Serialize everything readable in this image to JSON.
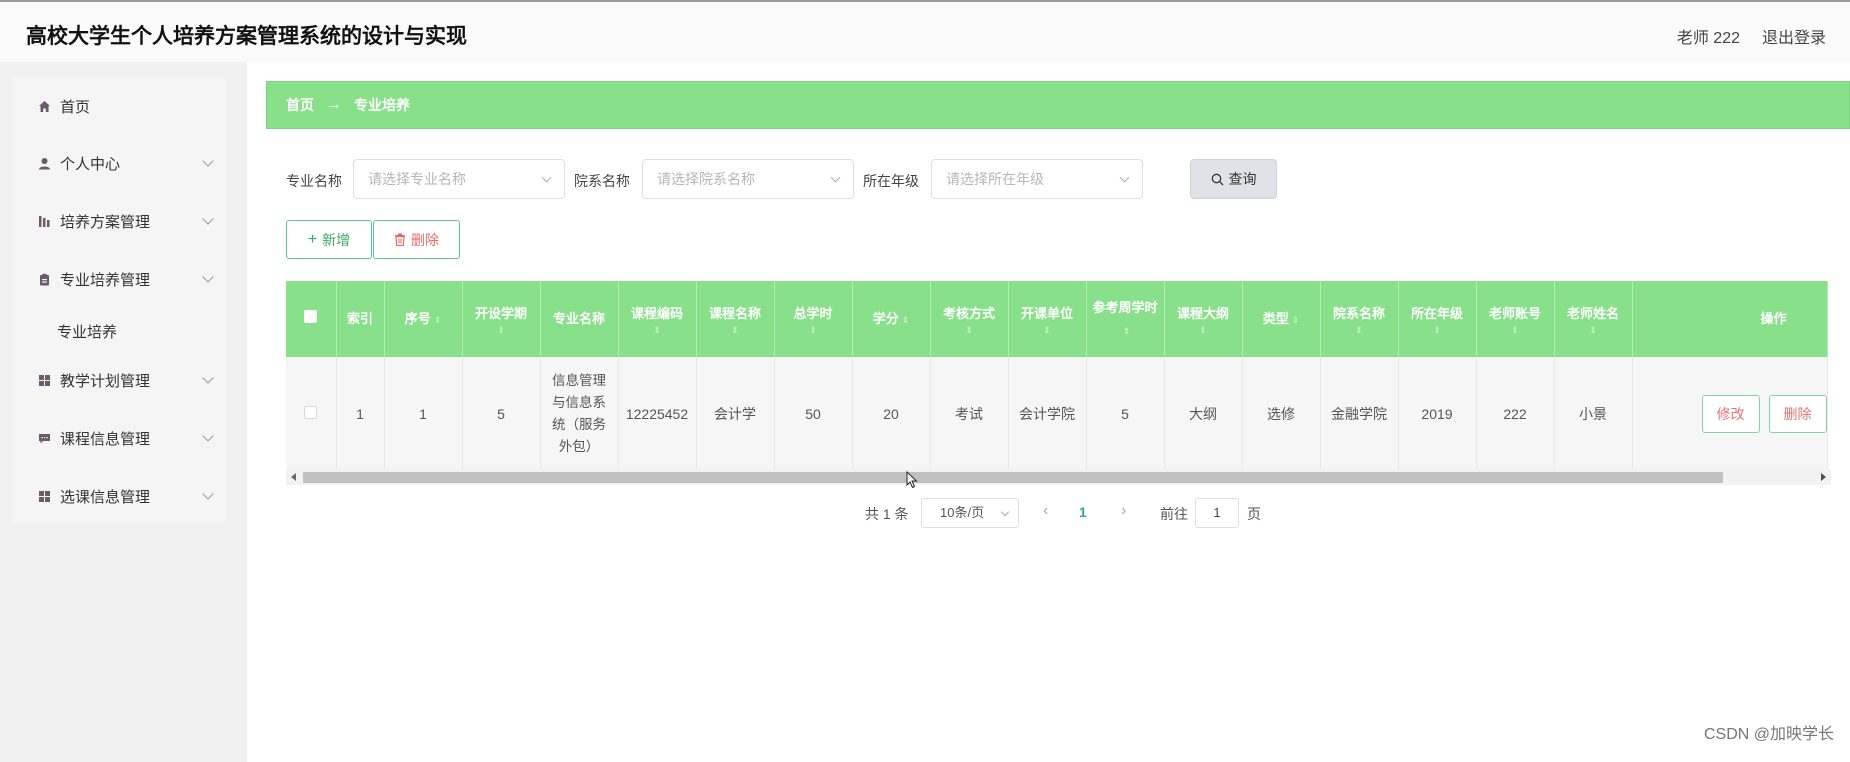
{
  "app": {
    "title": "高校大学生个人培养方案管理系统的设计与实现"
  },
  "header": {
    "user": "老师 222",
    "logout": "退出登录"
  },
  "sidebar": {
    "items": [
      {
        "label": "首页",
        "icon": "home-icon"
      },
      {
        "label": "个人中心",
        "icon": "user-icon"
      },
      {
        "label": "培养方案管理",
        "icon": "chart-icon"
      },
      {
        "label": "专业培养管理",
        "icon": "clipboard-icon"
      },
      {
        "label": "教学计划管理",
        "icon": "grid-icon"
      },
      {
        "label": "课程信息管理",
        "icon": "comment-icon"
      },
      {
        "label": "选课信息管理",
        "icon": "grid-icon"
      }
    ],
    "sub_item": "专业培养"
  },
  "breadcrumb": {
    "home": "首页",
    "arrow": "→",
    "current": "专业培养"
  },
  "filters": {
    "major_label": "专业名称",
    "major_placeholder": "请选择专业名称",
    "college_label": "院系名称",
    "college_placeholder": "请选择院系名称",
    "grade_label": "所在年级",
    "grade_placeholder": "请选择所在年级",
    "search_label": "查询"
  },
  "actions": {
    "add": "新增",
    "delete": "删除"
  },
  "table": {
    "headers": {
      "index": "索引",
      "seq": "序号",
      "semester": "开设学期",
      "major": "专业名称",
      "course_code": "课程编码",
      "course_name": "课程名称",
      "total_hours": "总学时",
      "credits": "学分",
      "assessment": "考核方式",
      "unit": "开课单位",
      "ref_hours": "参考周学时",
      "outline": "课程大纲",
      "type": "类型",
      "college": "院系名称",
      "grade": "所在年级",
      "teacher_account": "老师账号",
      "teacher_name": "老师姓名",
      "ops": "操作"
    },
    "rows": [
      {
        "index": "1",
        "seq": "1",
        "semester": "5",
        "major": "信息管理与信息系统（服务外包）",
        "course_code": "12225452",
        "course_name": "会计学",
        "total_hours": "50",
        "credits": "20",
        "assessment": "考试",
        "unit": "会计学院",
        "ref_hours": "5",
        "outline": "大纲",
        "type": "选修",
        "college": "金融学院",
        "grade": "2019",
        "teacher_account": "222",
        "teacher_name": "小景",
        "edit": "修改",
        "delete": "删除"
      }
    ]
  },
  "pagination": {
    "total": "共 1 条",
    "page_size": "10条/页",
    "current": "1",
    "goto": "前往",
    "goto_value": "1",
    "page": "页"
  },
  "watermark": "CSDN @加映学长",
  "colors": {
    "accent": "#88e08a",
    "danger": "#e57373",
    "link": "#28a8a0"
  }
}
